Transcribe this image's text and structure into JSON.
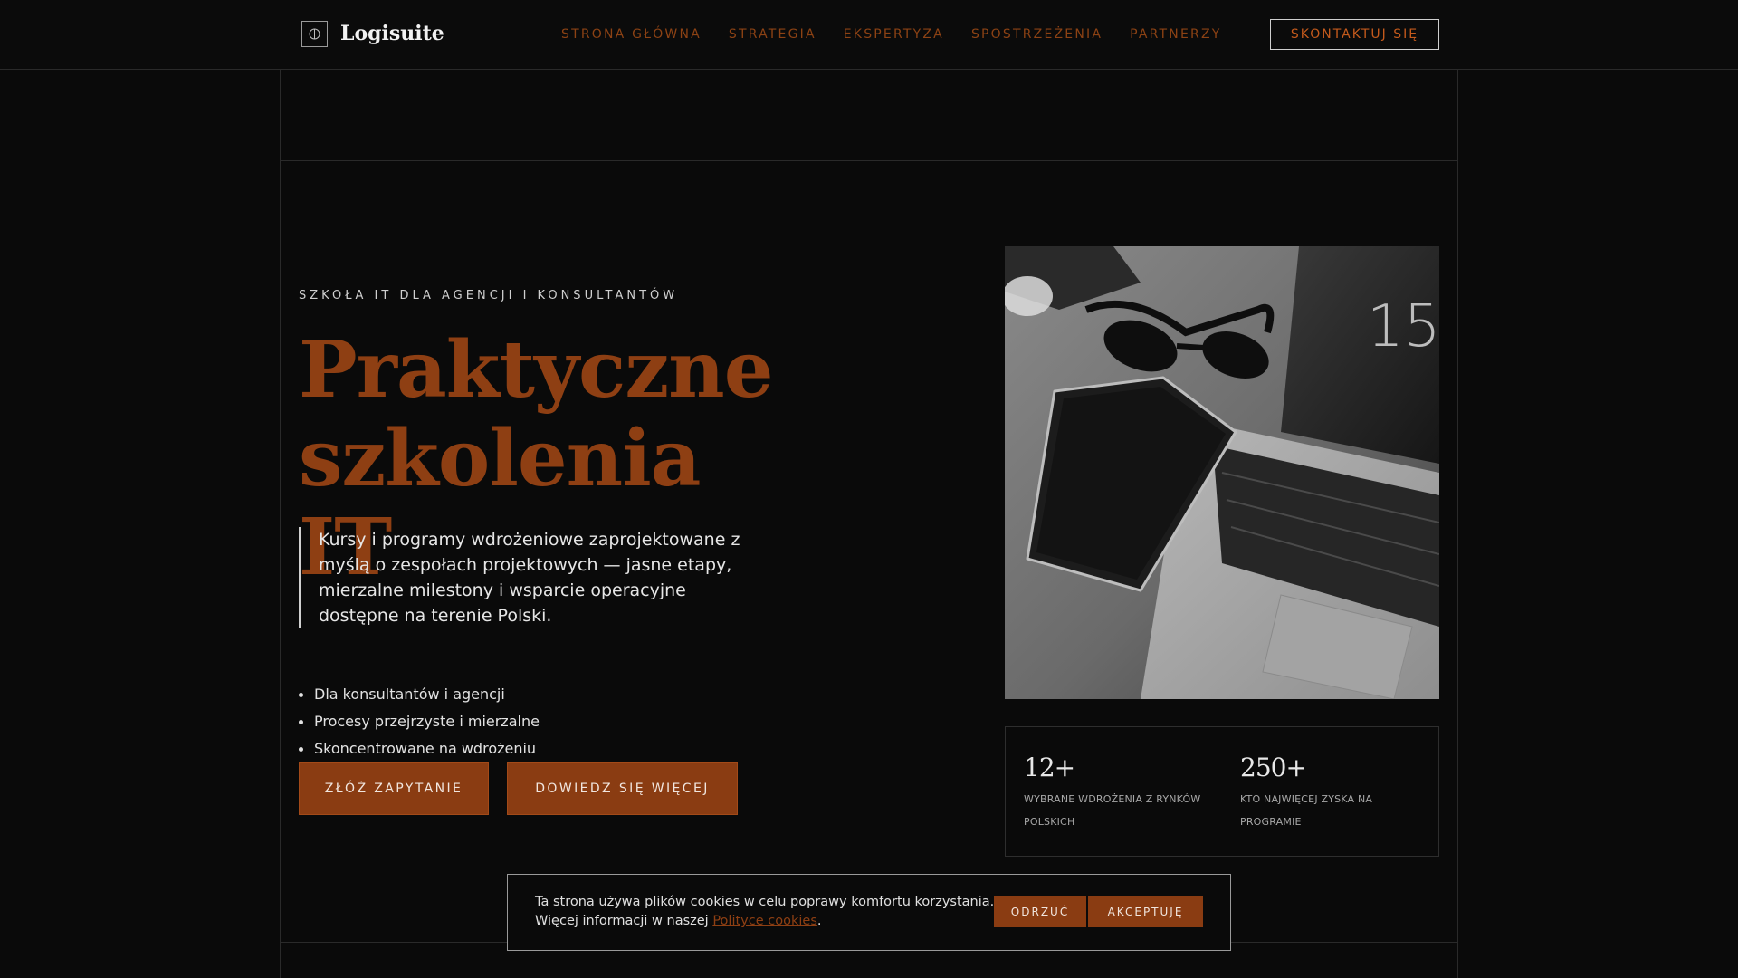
{
  "brand": {
    "name": "Logisuite",
    "icon": "globe-icon"
  },
  "nav": {
    "items": [
      {
        "label": "STRONA GŁÓWNA"
      },
      {
        "label": "STRATEGIA"
      },
      {
        "label": "EKSPERTYZA"
      },
      {
        "label": "SPOSTRZEŻENIA"
      },
      {
        "label": "PARTNERZY"
      }
    ],
    "cta": "SKONTAKTUJ SIĘ"
  },
  "hero": {
    "eyebrow": "SZKOŁA IT DLA AGENCJI I KONSULTANTÓW",
    "title_line1": "Praktyczne",
    "title_line2": "szkolenia IT",
    "lead": "Kursy i programy wdrożeniowe zaprojektowane z myślą o zespołach projektowych — jasne etapy, mierzalne milestony i wsparcie operacyjne dostępne na terenie Polski.",
    "bullets": [
      "Dla konsultantów i agencji",
      "Procesy przejrzyste i mierzalne",
      "Skoncentrowane na wdrożeniu"
    ],
    "primary_button": "ZŁÓŻ ZAPYTANIE",
    "secondary_button": "DOWIEDZ SIĘ WIĘCEJ",
    "image_screen_number": "15"
  },
  "stats": [
    {
      "value": "12+",
      "label": "WYBRANE WDROŻENIA Z RYNKÓW POLSKICH"
    },
    {
      "value": "250+",
      "label": "KTO NAJWIĘCEJ ZYSKA NA PROGRAMIE"
    }
  ],
  "cookie": {
    "text_line1": "Ta strona używa plików cookies w celu poprawy komfortu korzystania.",
    "text_line2_prefix": "Więcej informacji w naszej ",
    "link": "Polityce cookies",
    "text_suffix": ".",
    "reject": "ODRZUĆ",
    "accept": "AKCEPTUJĘ"
  },
  "colors": {
    "background": "#0a0a0a",
    "accent": "#8a3c12",
    "nav_text": "#8c4214"
  }
}
